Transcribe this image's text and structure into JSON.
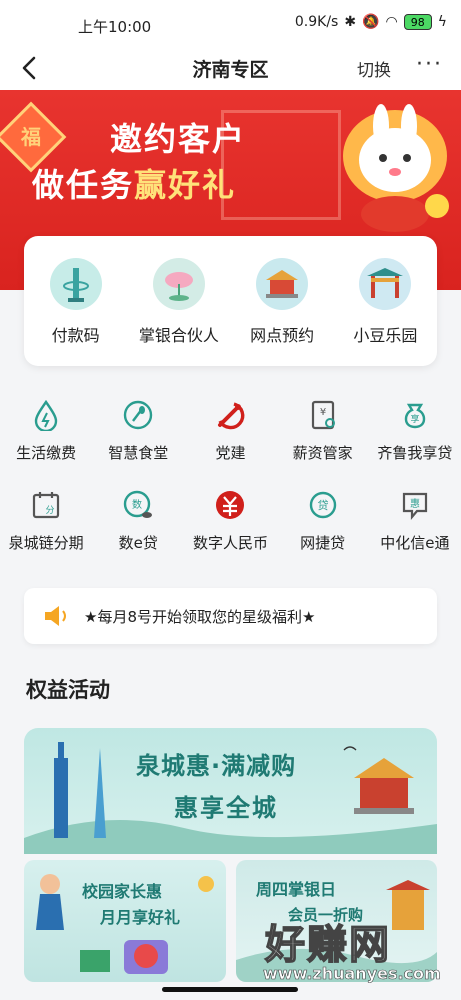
{
  "status_bar": {
    "time": "上午10:00",
    "net_speed": "0.9K/s",
    "battery": "98"
  },
  "nav": {
    "title": "济南专区",
    "switch_label": "切换",
    "more_label": "···"
  },
  "banner": {
    "fu": "福",
    "line1": "邀约客户",
    "line2_prefix": "做任务",
    "line2_highlight": "赢好礼"
  },
  "quick_actions": [
    {
      "label": "付款码",
      "icon": "tower-icon"
    },
    {
      "label": "掌银合伙人",
      "icon": "lotus-icon"
    },
    {
      "label": "网点预约",
      "icon": "pavilion-icon"
    },
    {
      "label": "小豆乐园",
      "icon": "gate-icon"
    }
  ],
  "services_row1": [
    {
      "label": "生活缴费",
      "icon": "water-drop-icon"
    },
    {
      "label": "智慧食堂",
      "icon": "utensils-icon"
    },
    {
      "label": "党建",
      "icon": "party-emblem-icon"
    },
    {
      "label": "薪资管家",
      "icon": "salary-doc-icon"
    },
    {
      "label": "齐鲁我享贷",
      "icon": "money-bag-icon",
      "glyph": "享"
    }
  ],
  "services_row2": [
    {
      "label": "泉城链分期",
      "icon": "calendar-icon",
      "glyph": "分"
    },
    {
      "label": "数e贷",
      "icon": "coin-icon",
      "glyph": "数"
    },
    {
      "label": "数字人民币",
      "icon": "digital-rmb-icon"
    },
    {
      "label": "网捷贷",
      "icon": "loan-icon",
      "glyph": "贷"
    },
    {
      "label": "中化信e通",
      "icon": "chat-bubble-icon",
      "glyph": "惠"
    }
  ],
  "notice": {
    "text": "★每月8号开始领取您的星级福利★"
  },
  "section": {
    "title": "权益活动"
  },
  "promo_main": {
    "line1": "泉城惠·满减购",
    "line2": "惠享全城"
  },
  "promo_left": {
    "line1": "校园家长惠",
    "line2": "月月享好礼"
  },
  "promo_right": {
    "line1": "周四掌银日",
    "line2": "会员一折购"
  },
  "watermark": {
    "brand": "好赚网",
    "url": "www.zhuanyes.com"
  },
  "colors": {
    "banner_red": "#e8342f",
    "teal": "#1f7a73",
    "icon_green": "#2a9d8f",
    "party_red": "#d0201b"
  }
}
